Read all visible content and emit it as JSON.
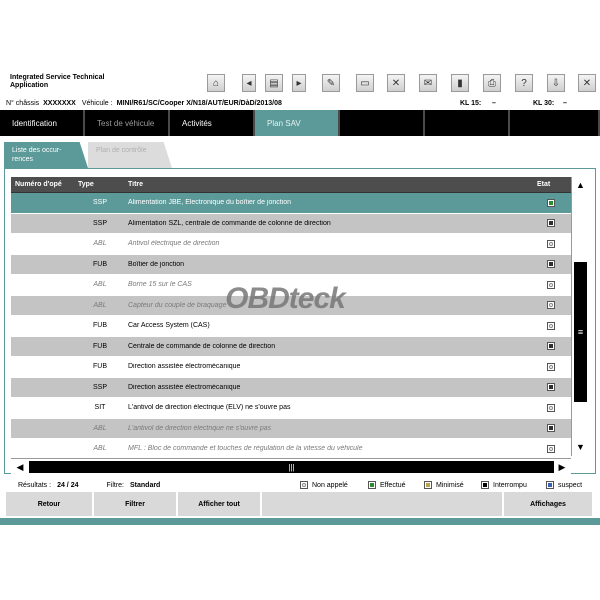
{
  "header": {
    "app_title": "Integrated Service Technical Application",
    "toolbar_icons": [
      "home-icon",
      "back-icon",
      "documents-icon",
      "forward-icon",
      "wrench-icon",
      "id-card-icon",
      "tools-icon",
      "mail-icon",
      "battery-icon",
      "printer-icon",
      "help-icon",
      "download-icon",
      "close-icon"
    ]
  },
  "vehicle_info": {
    "chassis_label": "N° châssis",
    "chassis_value": "XXXXXXX",
    "vehicle_label": "Véhicule :",
    "vehicle_value": "MINI/R61/SC/Cooper X/N18/AUT/EUR/DàD/2013/08",
    "kl15_label": "KL 15:",
    "kl15_value": "–",
    "kl30_label": "KL 30:",
    "kl30_value": "–"
  },
  "nav": {
    "tabs": [
      {
        "label": "Identification",
        "state": "normal"
      },
      {
        "label": "Test de véhicule",
        "state": "dim"
      },
      {
        "label": "Activités",
        "state": "normal"
      },
      {
        "label": "Plan SAV",
        "state": "active"
      }
    ]
  },
  "subtabs": {
    "active_label": "Liste des occur-\nrences",
    "inactive_label": "Plan de contrôle"
  },
  "table": {
    "headers": {
      "num": "Numéro d'opé",
      "type": "Type",
      "title": "Titre",
      "etat": "Etat"
    },
    "rows": [
      {
        "num": "",
        "type": "SSP",
        "title": "Alimentation JBE, Electronique du boîtier de jonction",
        "style": "sel",
        "italic": false,
        "etat": "green"
      },
      {
        "num": "",
        "type": "SSP",
        "title": "Alimentation SZL, centrale de commande de colonne de direction",
        "style": "grey",
        "italic": false,
        "etat": "filled"
      },
      {
        "num": "",
        "type": "ABL",
        "title": "Antivol électrique de direction",
        "style": "white",
        "italic": true,
        "etat": "hollow"
      },
      {
        "num": "",
        "type": "FUB",
        "title": "Boîtier de jonction",
        "style": "grey",
        "italic": false,
        "etat": "filled"
      },
      {
        "num": "",
        "type": "ABL",
        "title": "Borne 15 sur le CAS",
        "style": "white",
        "italic": true,
        "etat": "hollow"
      },
      {
        "num": "",
        "type": "ABL",
        "title": "Capteur du couple de braquage",
        "style": "grey",
        "italic": true,
        "etat": "hollow"
      },
      {
        "num": "",
        "type": "FUB",
        "title": "Car Access System (CAS)",
        "style": "white",
        "italic": false,
        "etat": "hollow"
      },
      {
        "num": "",
        "type": "FUB",
        "title": "Centrale de commande de colonne de direction",
        "style": "grey",
        "italic": false,
        "etat": "filled"
      },
      {
        "num": "",
        "type": "FUB",
        "title": "Direction assistée électromécanique",
        "style": "white",
        "italic": false,
        "etat": "hollow"
      },
      {
        "num": "",
        "type": "SSP",
        "title": "Direction assistée électromécanique",
        "style": "grey",
        "italic": false,
        "etat": "filled"
      },
      {
        "num": "",
        "type": "SIT",
        "title": "L'antivol de direction électrique (ELV) ne s'ouvre pas",
        "style": "white",
        "italic": false,
        "etat": "hollow"
      },
      {
        "num": "",
        "type": "ABL",
        "title": "L'antivol de direction électrique ne s'ouvre pas",
        "style": "grey",
        "italic": true,
        "etat": "filled"
      },
      {
        "num": "",
        "type": "ABL",
        "title": "MFL : Bloc de commande et touches de régulation de la vitesse du véhicule",
        "style": "white",
        "italic": true,
        "etat": "hollow"
      }
    ]
  },
  "watermark": "OBDteck",
  "status": {
    "results_label": "Résultats :",
    "results_value": "24  /  24",
    "filter_label": "Filtre:",
    "filter_value": "Standard"
  },
  "legend": [
    {
      "label": "Non appelé",
      "color": "#ffffff"
    },
    {
      "label": "Effectué",
      "color": "#2e8a2e"
    },
    {
      "label": "Minimisé",
      "color": "#b8a24a"
    },
    {
      "label": "Interrompu",
      "color": "#000000"
    },
    {
      "label": "suspect",
      "color": "#3a5fb0"
    }
  ],
  "buttons": {
    "retour": "Retour",
    "filtrer": "Filtrer",
    "afficher_tout": "Afficher tout",
    "affichages": "Affichages"
  },
  "colors": {
    "accent": "#5b9a99",
    "nav_bg": "#000000",
    "row_grey": "#c4c4c4"
  }
}
